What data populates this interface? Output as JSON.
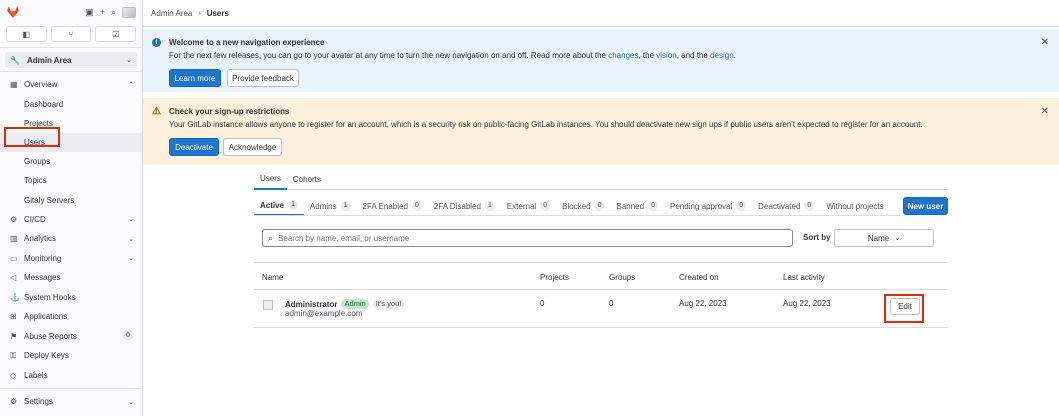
{
  "header": {
    "breadcrumb_root": "Admin Area",
    "breadcrumb_current": "Users"
  },
  "sidebar": {
    "count_issues": "",
    "context": "Admin Area",
    "overview_label": "Overview",
    "overview_items": [
      "Dashboard",
      "Projects",
      "Users",
      "Groups",
      "Topics",
      "Gitaly Servers"
    ],
    "items": [
      {
        "label": "CI/CD",
        "icon": "rocket-icon"
      },
      {
        "label": "Analytics",
        "icon": "chart-icon"
      },
      {
        "label": "Monitoring",
        "icon": "monitor-icon"
      },
      {
        "label": "Messages",
        "icon": "bullhorn-icon"
      },
      {
        "label": "System Hooks",
        "icon": "hook-icon"
      },
      {
        "label": "Applications",
        "icon": "apps-icon"
      },
      {
        "label": "Abuse Reports",
        "icon": "flag-icon",
        "badge": "0"
      },
      {
        "label": "Deploy Keys",
        "icon": "key-icon"
      },
      {
        "label": "Labels",
        "icon": "label-icon"
      }
    ],
    "settings_label": "Settings"
  },
  "alerts": {
    "info": {
      "title": "Welcome to a new navigation experience",
      "body_prefix": "For the next few releases, you can go to your avatar at any time to turn the new navigation on and off. Read more about the ",
      "link_changes": "changes",
      "body_mid1": ", the ",
      "link_vision": "vision",
      "body_mid2": ", and the ",
      "link_design": "design",
      "body_suffix": ".",
      "btn_primary": "Learn more",
      "btn_secondary": "Provide feedback"
    },
    "warning": {
      "title": "Check your sign-up restrictions",
      "body": "Your GitLab instance allows anyone to register for an account, which is a security risk on public-facing GitLab instances. You should deactivate new sign ups if public users aren't expected to register for an account.",
      "btn_primary": "Deactivate",
      "btn_secondary": "Acknowledge"
    }
  },
  "main": {
    "top_tabs": [
      "Users",
      "Cohorts"
    ],
    "filter_tabs": [
      {
        "label": "Active",
        "count": "1"
      },
      {
        "label": "Admins",
        "count": "1"
      },
      {
        "label": "2FA Enabled",
        "count": "0"
      },
      {
        "label": "2FA Disabled",
        "count": "1"
      },
      {
        "label": "External",
        "count": "0"
      },
      {
        "label": "Blocked",
        "count": "0"
      },
      {
        "label": "Banned",
        "count": "0"
      },
      {
        "label": "Pending approval",
        "count": "0"
      },
      {
        "label": "Deactivated",
        "count": "0"
      },
      {
        "label": "Without projects",
        "count": ""
      }
    ],
    "new_user_label": "New user",
    "search_placeholder": "Search by name, email, or username",
    "sort_label": "Sort by",
    "sort_value": "Name",
    "table": {
      "columns": [
        "Name",
        "Projects",
        "Groups",
        "Created on",
        "Last activity"
      ],
      "rows": [
        {
          "name": "Administrator",
          "badge_admin": "Admin",
          "badge_you": "It's you!",
          "email": "admin@example.com",
          "projects": "0",
          "groups": "0",
          "created_on": "Aug 22, 2023",
          "last_activity": "Aug 22, 2023",
          "action": "Edit"
        }
      ]
    }
  },
  "colors": {
    "primary": "#1f75cb",
    "info_bg": "#e9f3fc",
    "warning_bg": "#fdf1dd",
    "highlight": "#dd2b0e"
  }
}
